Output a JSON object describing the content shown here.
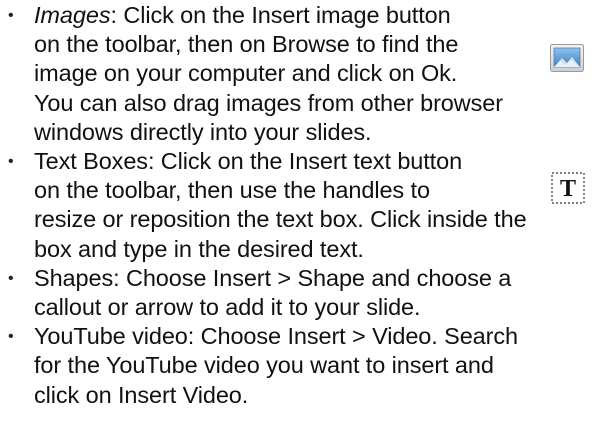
{
  "items": [
    {
      "term": "Images",
      "lines": [
        ": Click on the Insert image button",
        "on the toolbar, then on Browse to find the",
        "image on your computer and click on Ok.",
        "You can also drag images from other browser",
        "windows directly into your slides."
      ]
    },
    {
      "lines": [
        "Text Boxes: Click on the Insert text button",
        "on the toolbar, then use the handles to",
        "resize or reposition the text box. Click inside the",
        "box and type in the desired text."
      ]
    },
    {
      "lines": [
        "Shapes: Choose Insert > Shape and choose a",
        "callout or arrow to add it to your slide."
      ]
    },
    {
      "lines": [
        "YouTube video: Choose Insert > Video. Search",
        "for the YouTube video you want to insert and",
        "click on Insert Video."
      ]
    }
  ],
  "bullet_char": "•",
  "icons": {
    "image_icon": "insert-image-icon",
    "textbox_icon": "insert-text-icon",
    "textbox_glyph": "T"
  },
  "colors": {
    "text": "#111111",
    "image_icon_sky": "#4a8fcf"
  }
}
